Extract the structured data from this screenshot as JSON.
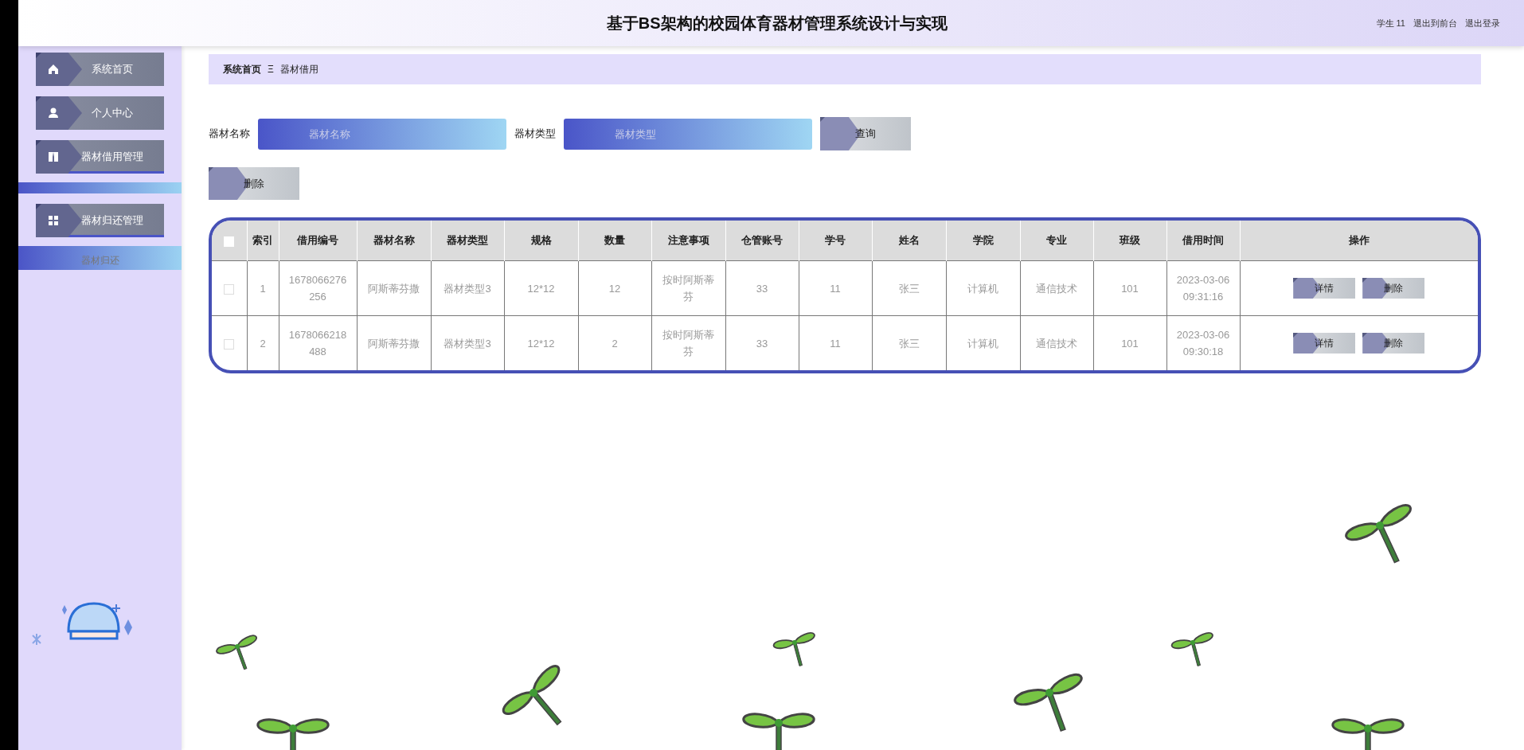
{
  "header": {
    "title": "基于BS架构的校园体育器材管理系统设计与实现",
    "user": "学生 11",
    "links": [
      "退出到前台",
      "退出登录"
    ]
  },
  "sidebar": {
    "items": [
      {
        "label": "系统首页",
        "expanded": false
      },
      {
        "label": "个人中心",
        "expanded": false
      },
      {
        "label": "器材借用管理",
        "expanded": true
      },
      {
        "label": "器材归还管理",
        "expanded": true,
        "children": [
          {
            "label": "器材归还",
            "selected": true
          }
        ]
      }
    ]
  },
  "breadcrumb": {
    "items": [
      "系统首页",
      "器材借用"
    ],
    "separator": "Ξ"
  },
  "search": {
    "fields": [
      {
        "label": "器材名称",
        "placeholder": "器材名称"
      },
      {
        "label": "器材类型",
        "placeholder": "器材类型"
      }
    ],
    "button": "查询"
  },
  "delete_button": "删除",
  "table": {
    "header_checked": false,
    "columns": [
      "索引",
      "借用编号",
      "器材名称",
      "器材类型",
      "规格",
      "数量",
      "注意事项",
      "仓管账号",
      "学号",
      "姓名",
      "学院",
      "专业",
      "班级",
      "借用时间",
      "操作"
    ],
    "rows": [
      {
        "checked": false,
        "cells": [
          "1",
          "1678066276256",
          "阿斯蒂芬撒",
          "器材类型3",
          "12*12",
          "12",
          "按时阿斯蒂芬",
          "33",
          "11",
          "张三",
          "计算机",
          "通信技术",
          "101",
          "2023-03-06 09:31:16"
        ],
        "actions": [
          "详情",
          "删除"
        ]
      },
      {
        "checked": false,
        "cells": [
          "2",
          "1678066218488",
          "阿斯蒂芬撒",
          "器材类型3",
          "12*12",
          "2",
          "按时阿斯蒂芬",
          "33",
          "11",
          "张三",
          "计算机",
          "通信技术",
          "101",
          "2023-03-06 09:30:18"
        ],
        "actions": [
          "详情",
          "删除"
        ]
      }
    ]
  }
}
